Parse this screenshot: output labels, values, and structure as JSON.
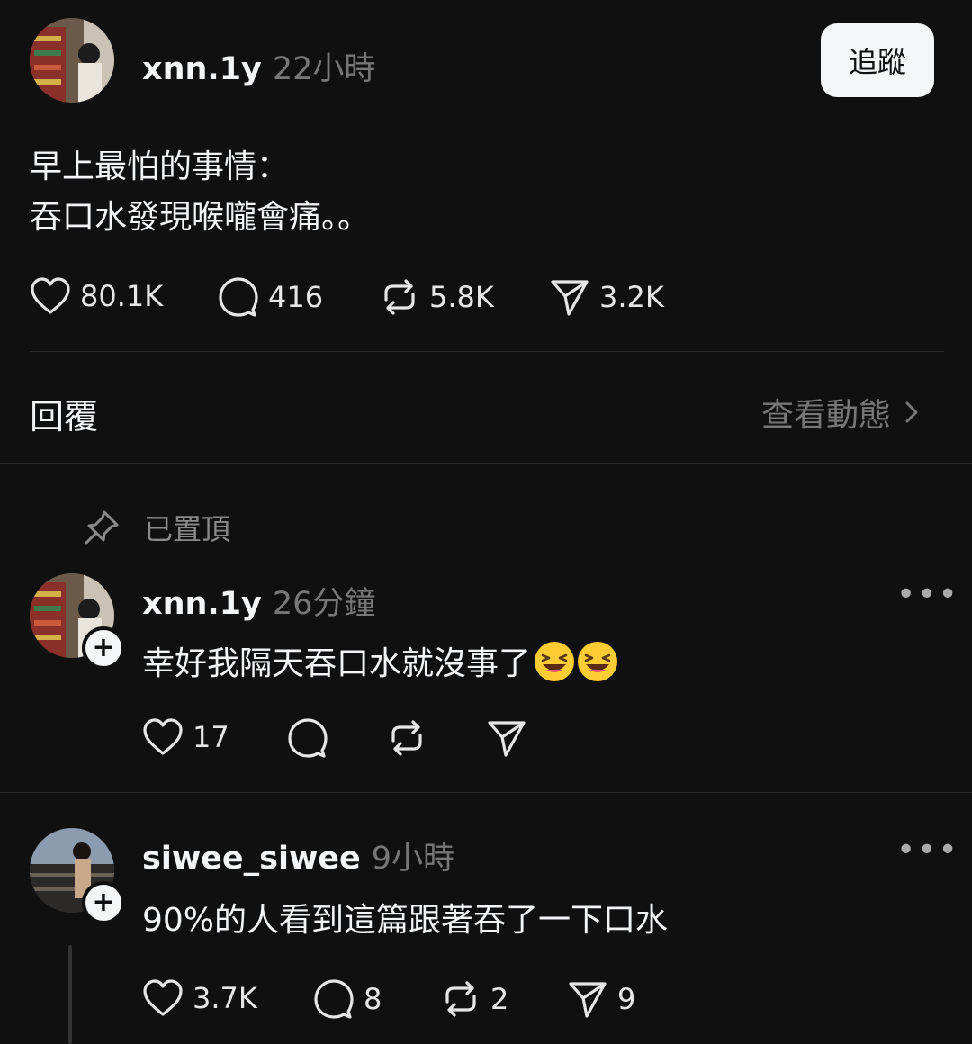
{
  "post": {
    "username": "xnn.1y",
    "time": "22小時",
    "follow_label": "追蹤",
    "text_lines": [
      "早上最怕的事情：",
      "吞口水發現喉嚨會痛。。"
    ],
    "likes": "80.1K",
    "comments": "416",
    "reposts": "5.8K",
    "shares": "3.2K"
  },
  "replies_bar": {
    "label": "回覆",
    "activity_label": "查看動態"
  },
  "pinned_label": "已置頂",
  "comments": [
    {
      "username": "xnn.1y",
      "time": "26分鐘",
      "text": "幸好我隔天吞口水就沒事了",
      "emojis": [
        "laughing-emoji",
        "laughing-emoji"
      ],
      "likes": "17"
    },
    {
      "username": "siwee_siwee",
      "time": "9小時",
      "text": "90%的人看到這篇跟著吞了一下口水",
      "likes": "3.7K",
      "comments": "8",
      "reposts": "2",
      "shares": "9"
    }
  ],
  "colors": {
    "background": "#101010",
    "text": "#f3f5f7",
    "muted": "#777777",
    "button_bg": "#f3f5f7"
  }
}
